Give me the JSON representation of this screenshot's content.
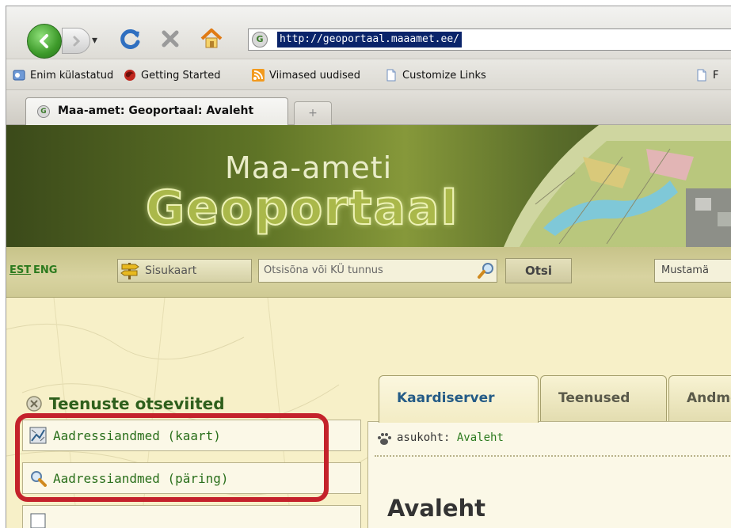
{
  "browser": {
    "url": "http://geoportaal.maaamet.ee/",
    "site_icon_glyph": "G",
    "bookmarks": [
      {
        "label": "Enim külastatud",
        "icon": "most-visited-icon"
      },
      {
        "label": "Getting Started",
        "icon": "firefox-icon"
      },
      {
        "label": "Viimased uudised",
        "icon": "rss-icon"
      },
      {
        "label": "Customize Links",
        "icon": "page-icon"
      },
      {
        "label": "F",
        "icon": "page-icon"
      }
    ],
    "tab": {
      "title": "Maa-amet: Geoportaal: Avaleht",
      "new_tab_glyph": "+"
    }
  },
  "site": {
    "banner": {
      "subtitle": "Maa-ameti",
      "title": "Geoportaal"
    },
    "toolbar": {
      "lang_est": "EST",
      "lang_eng": "ENG",
      "sitemap_label": "Sisukaart",
      "search_placeholder": "Otsisõna või KÜ tunnus",
      "search_button": "Otsi",
      "place_value": "Mustamä"
    },
    "tabs": [
      "Kaardiserver",
      "Teenused",
      "Andmed"
    ],
    "sidebar": {
      "heading": "Teenuste otseviited",
      "items": [
        "Aadressiandmed (kaart)",
        "Aadressiandmed (päring)",
        ""
      ]
    },
    "main": {
      "location_label": "asukoht:",
      "location_link": "Avaleht",
      "heading": "Avaleht"
    }
  },
  "colors": {
    "highlight": "#c4222b",
    "link_green": "#2c7a1e",
    "active_tab_text": "#245b86"
  }
}
